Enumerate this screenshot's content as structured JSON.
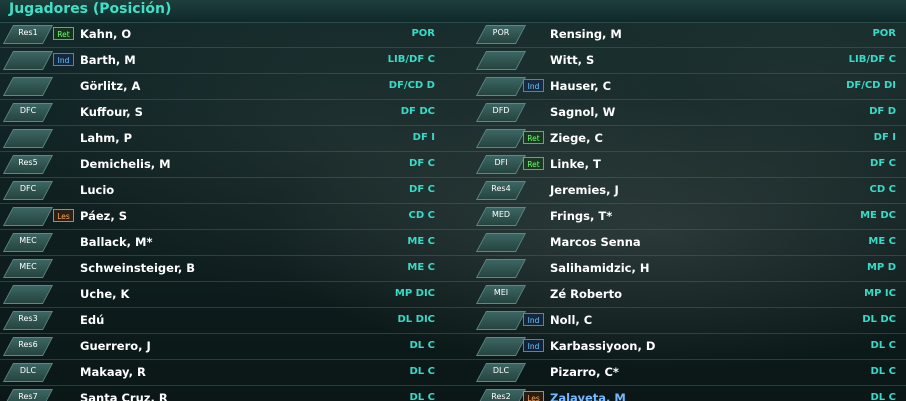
{
  "panel": {
    "title": "Jugadores (Posición)"
  },
  "left": [
    {
      "pos": "Res1",
      "badge": "Ret",
      "name": "Kahn, O",
      "role": "POR"
    },
    {
      "pos": "",
      "badge": "Ind",
      "name": "Barth, M",
      "role": "LIB/DF C"
    },
    {
      "pos": "",
      "badge": "",
      "name": "Görlitz, A",
      "role": "DF/CD D"
    },
    {
      "pos": "DFC",
      "badge": "",
      "name": "Kuffour, S",
      "role": "DF DC"
    },
    {
      "pos": "",
      "badge": "",
      "name": "Lahm, P",
      "role": "DF I"
    },
    {
      "pos": "Res5",
      "badge": "",
      "name": "Demichelis, M",
      "role": "DF C"
    },
    {
      "pos": "DFC",
      "badge": "",
      "name": "Lucio",
      "role": "DF C"
    },
    {
      "pos": "",
      "badge": "Les",
      "name": "Páez, S",
      "role": "CD C"
    },
    {
      "pos": "MEC",
      "badge": "",
      "name": "Ballack, M*",
      "role": "ME C"
    },
    {
      "pos": "MEC",
      "badge": "",
      "name": "Schweinsteiger, B",
      "role": "ME C"
    },
    {
      "pos": "",
      "badge": "",
      "name": "Uche, K",
      "role": "MP DIC"
    },
    {
      "pos": "Res3",
      "badge": "",
      "name": "Edú",
      "role": "DL DIC"
    },
    {
      "pos": "Res6",
      "badge": "",
      "name": "Guerrero, J",
      "role": "DL C"
    },
    {
      "pos": "DLC",
      "badge": "",
      "name": "Makaay, R",
      "role": "DL C"
    },
    {
      "pos": "Res7",
      "badge": "",
      "name": "Santa Cruz, R",
      "role": "DL C"
    }
  ],
  "right": [
    {
      "pos": "POR",
      "badge": "",
      "name": "Rensing, M",
      "role": "POR"
    },
    {
      "pos": "",
      "badge": "",
      "name": "Witt, S",
      "role": "LIB/DF C"
    },
    {
      "pos": "",
      "badge": "Ind",
      "name": "Hauser, C",
      "role": "DF/CD DI"
    },
    {
      "pos": "DFD",
      "badge": "",
      "name": "Sagnol, W",
      "role": "DF D"
    },
    {
      "pos": "",
      "badge": "Ret",
      "name": "Ziege, C",
      "role": "DF I"
    },
    {
      "pos": "DFI",
      "badge": "Ret",
      "name": "Linke, T",
      "role": "DF C"
    },
    {
      "pos": "Res4",
      "badge": "",
      "name": "Jeremies, J",
      "role": "CD C"
    },
    {
      "pos": "MED",
      "badge": "",
      "name": "Frings, T*",
      "role": "ME DC"
    },
    {
      "pos": "",
      "badge": "",
      "name": "Marcos Senna",
      "role": "ME C"
    },
    {
      "pos": "",
      "badge": "",
      "name": "Salihamidzic, H",
      "role": "MP D"
    },
    {
      "pos": "MEI",
      "badge": "",
      "name": "Zé Roberto",
      "role": "MP IC"
    },
    {
      "pos": "",
      "badge": "Ind",
      "name": "Noll, C",
      "role": "DL DC"
    },
    {
      "pos": "",
      "badge": "Ind",
      "name": "Karbassiyoon, D",
      "role": "DL C"
    },
    {
      "pos": "DLC",
      "badge": "",
      "name": "Pizarro, C*",
      "role": "DL C"
    },
    {
      "pos": "Res2",
      "badge": "Les",
      "name": "Zalayeta, M",
      "role": "DL C",
      "highlight": true
    }
  ]
}
